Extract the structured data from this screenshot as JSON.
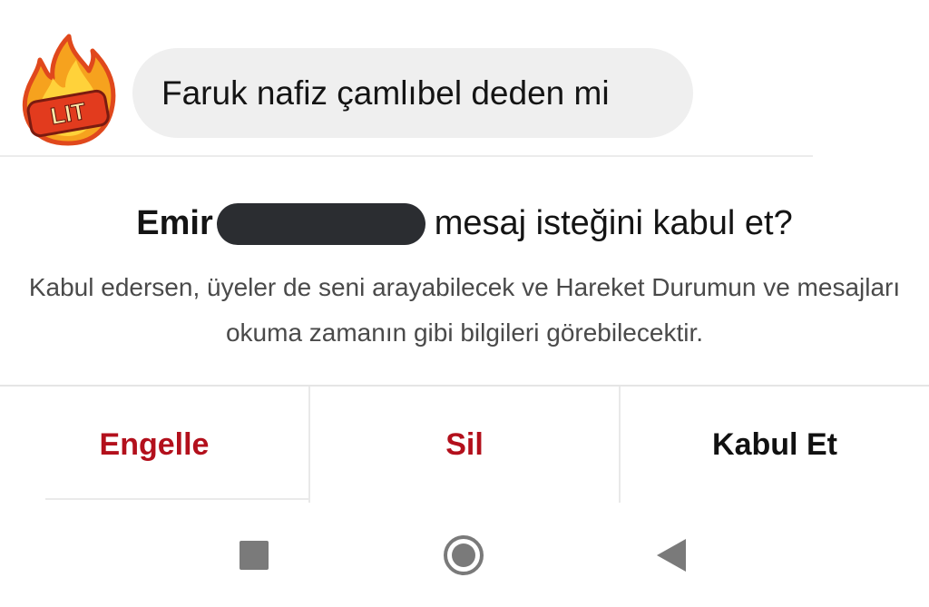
{
  "message": {
    "avatar_icon": "lit-fire-sticker-icon",
    "avatar_text": "LIT",
    "text": "Faruk nafiz çamlıbel deden mi"
  },
  "request": {
    "sender_name": "Emir",
    "title_suffix": "mesaj isteğini kabul et?",
    "description": "Kabul edersen, üyeler de seni arayabilecek ve Hareket Durumun ve mesajları okuma zamanın gibi bilgileri görebilecektir."
  },
  "actions": {
    "block_label": "Engelle",
    "delete_label": "Sil",
    "accept_label": "Kabul Et"
  },
  "navbar": {
    "recent_icon": "square-recents-icon",
    "home_icon": "circle-home-icon",
    "back_icon": "triangle-back-icon"
  },
  "colors": {
    "danger": "#b3101c",
    "bubble": "#efefef",
    "redaction": "#2b2d31",
    "nav_icon": "#7a7a7a"
  }
}
